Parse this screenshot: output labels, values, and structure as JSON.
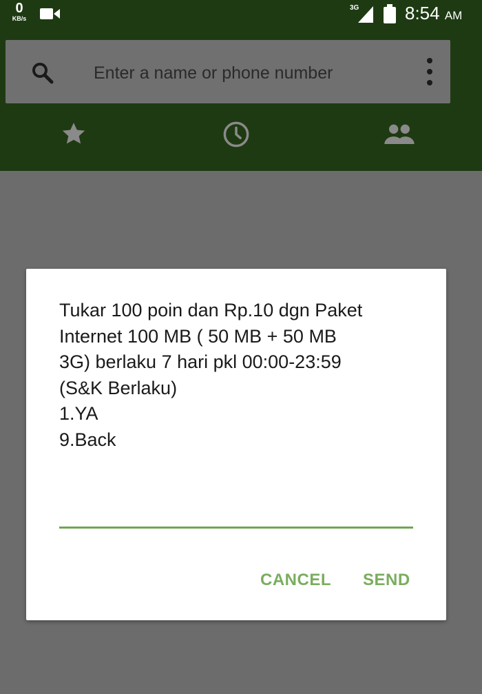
{
  "status_bar": {
    "net_speed_value": "0",
    "net_speed_unit": "KB/s",
    "network_type": "3G",
    "time": "8:54",
    "ampm": "AM"
  },
  "search": {
    "placeholder": "Enter a name or phone number"
  },
  "tabs": [
    {
      "icon": "star-icon"
    },
    {
      "icon": "clock-icon"
    },
    {
      "icon": "contacts-icon"
    }
  ],
  "dialog": {
    "message_lines": [
      "Tukar 100 poin dan Rp.10 dgn Paket",
      "Internet 100 MB ( 50 MB + 50 MB",
      "3G) berlaku 7 hari pkl 00:00-23:59",
      "(S&K Berlaku)",
      "1.YA",
      "9.Back"
    ],
    "reply_value": "",
    "cancel_label": "CANCEL",
    "send_label": "SEND"
  },
  "colors": {
    "header_green": "#1e3a12",
    "accent_green": "#7aad5e",
    "scrim": "#6c6c6c"
  }
}
